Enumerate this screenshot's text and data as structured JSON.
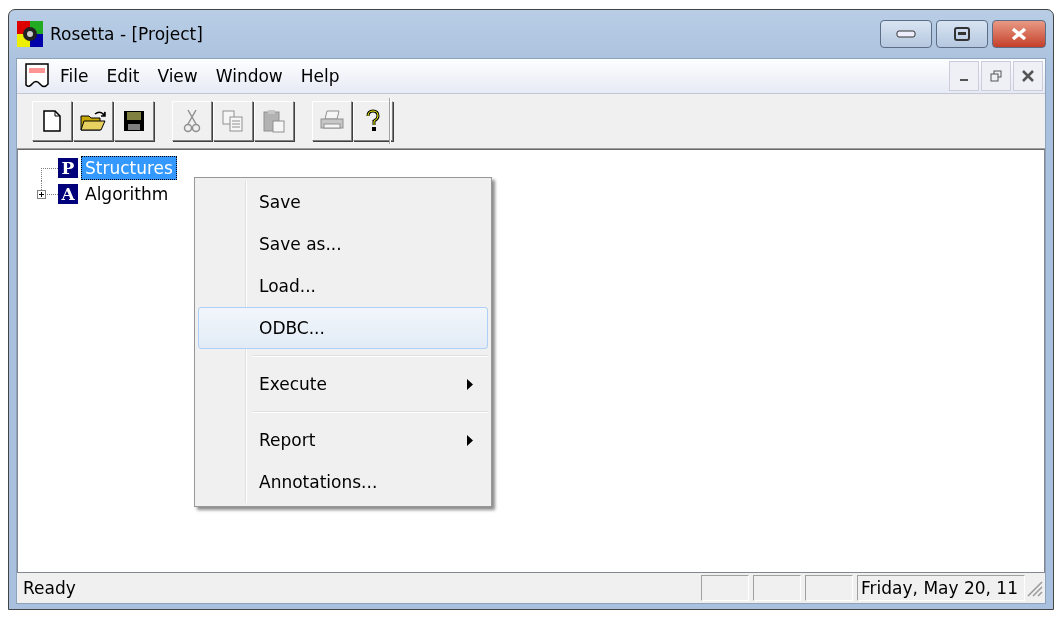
{
  "window": {
    "title": "Rosetta - [Project]"
  },
  "menu_bar": {
    "items": [
      "File",
      "Edit",
      "View",
      "Window",
      "Help"
    ]
  },
  "toolbar": [
    {
      "kind": "new",
      "disabled": false
    },
    {
      "kind": "open",
      "disabled": false
    },
    {
      "kind": "save",
      "disabled": false
    },
    {
      "kind": "cut",
      "disabled": true
    },
    {
      "kind": "copy",
      "disabled": true
    },
    {
      "kind": "paste",
      "disabled": true
    },
    {
      "kind": "print",
      "disabled": true
    },
    {
      "kind": "help",
      "disabled": false
    }
  ],
  "tree": [
    {
      "badge": "P",
      "label": "Structures",
      "selected": true,
      "expandable": false
    },
    {
      "badge": "A",
      "label": "Algorithm",
      "selected": false,
      "expandable": true
    }
  ],
  "context_menu": [
    {
      "kind": "item",
      "label": "Save",
      "selected": false,
      "submenu": false
    },
    {
      "kind": "item",
      "label": "Save as...",
      "selected": false,
      "submenu": false
    },
    {
      "kind": "item",
      "label": "Load...",
      "selected": false,
      "submenu": false
    },
    {
      "kind": "item",
      "label": "ODBC...",
      "selected": true,
      "submenu": false
    },
    {
      "kind": "separator"
    },
    {
      "kind": "item",
      "label": "Execute",
      "selected": false,
      "submenu": true
    },
    {
      "kind": "separator"
    },
    {
      "kind": "item",
      "label": "Report",
      "selected": false,
      "submenu": true
    },
    {
      "kind": "item",
      "label": "Annotations...",
      "selected": false,
      "submenu": false
    }
  ],
  "status_bar": {
    "message": "Ready",
    "date": "Friday, May 20, 11"
  }
}
